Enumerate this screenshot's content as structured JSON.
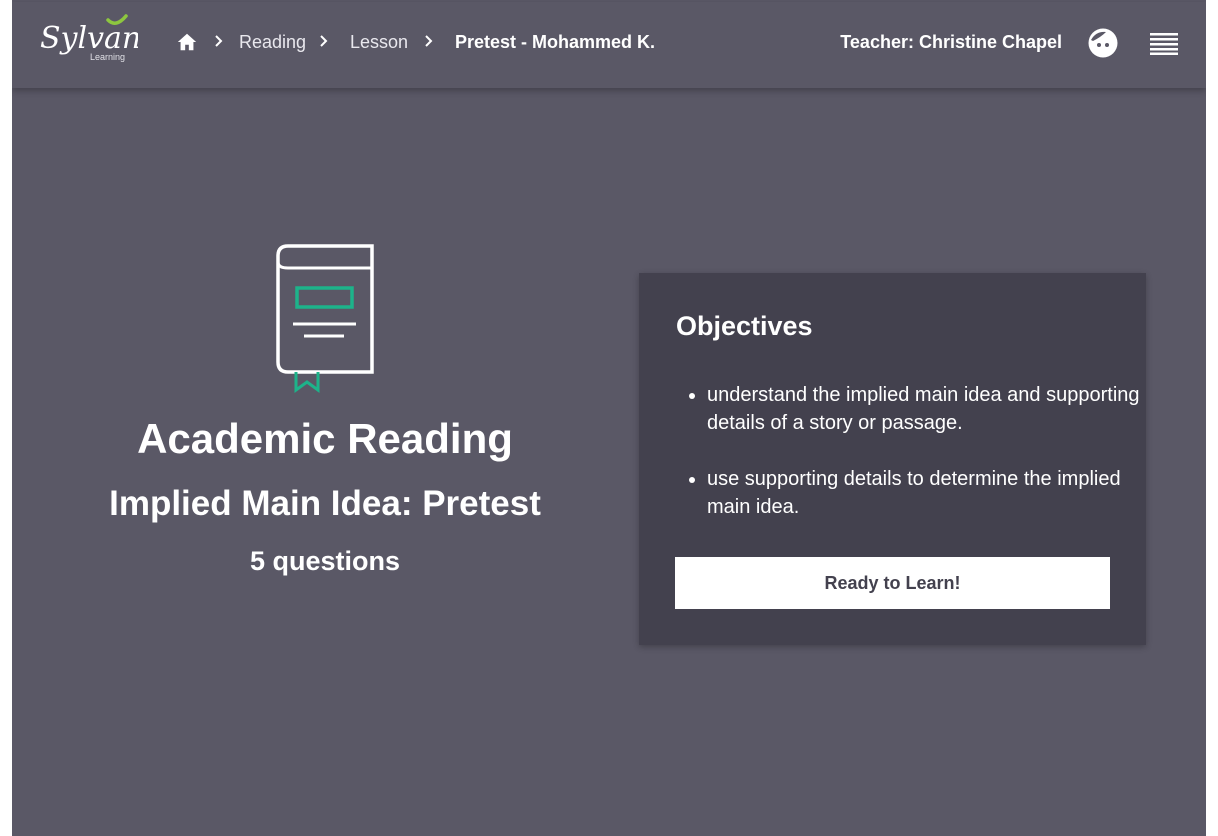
{
  "header": {
    "logo_text": "Sylvan",
    "logo_subtext": "Learning",
    "breadcrumb": [
      {
        "label": "Reading"
      },
      {
        "label": "Lesson"
      },
      {
        "label": "Pretest - Mohammed K."
      }
    ],
    "teacher_label": "Teacher: Christine Chapel",
    "icons": {
      "home": "home-icon",
      "avatar": "student-face-icon",
      "menu": "hamburger-menu-icon"
    }
  },
  "lesson": {
    "subject": "Academic Reading",
    "title": "Implied Main Idea: Pretest",
    "question_count": "5 questions",
    "icon": "book-icon"
  },
  "objectives": {
    "heading": "Objectives",
    "items": [
      "understand the implied main idea and supporting details of a story or passage.",
      "use supporting details to determine the implied main idea."
    ],
    "button_label": "Ready to Learn!"
  },
  "colors": {
    "background": "#5a5866",
    "card": "#43414e",
    "accent": "#1db38a",
    "logo_accent": "#8dc63f"
  }
}
